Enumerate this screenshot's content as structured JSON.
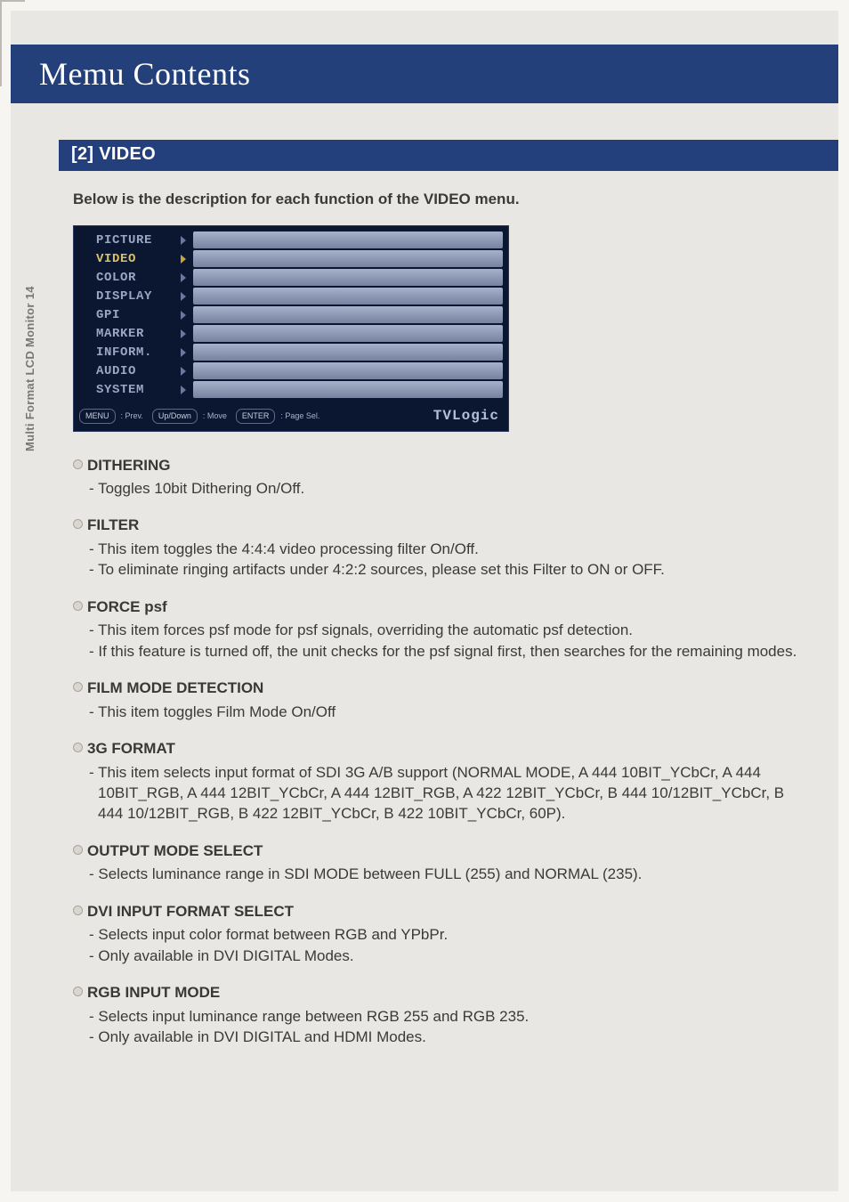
{
  "page": {
    "title": "Memu Contents",
    "section": "[2] VIDEO",
    "sidebar": "Multi Format LCD Monitor 14",
    "intro": "Below is the description for each function of the VIDEO menu."
  },
  "osd": {
    "menu": [
      "PICTURE",
      "VIDEO",
      "COLOR",
      "DISPLAY",
      "GPI",
      "MARKER",
      "INFORM.",
      "AUDIO",
      "SYSTEM"
    ],
    "selected_index": 1,
    "footer": {
      "prev_btn": "MENU",
      "prev_lbl": ": Prev.",
      "move_btn": "Up/Down",
      "move_lbl": ": Move",
      "page_btn": "ENTER",
      "page_lbl": ": Page Sel.",
      "logo": "TVLogic"
    }
  },
  "items": [
    {
      "heading": "DITHERING",
      "bullets": [
        " Toggles 10bit Dithering On/Off."
      ]
    },
    {
      "heading": "FILTER",
      "bullets": [
        "This item toggles the 4:4:4 video processing filter On/Off.",
        "To eliminate ringing artifacts under 4:2:2 sources, please set this Filter to ON or OFF."
      ]
    },
    {
      "heading": "FORCE psf",
      "bullets": [
        "This item forces psf mode for psf signals, overriding the automatic psf detection.",
        "If this feature is turned off, the unit checks for the psf signal first, then searches for the remaining modes."
      ]
    },
    {
      "heading": "FILM MODE DETECTION",
      "bullets": [
        "This item toggles Film Mode On/Off"
      ]
    },
    {
      "heading": " 3G FORMAT",
      "bullets": [
        "This item selects input format of SDI 3G A/B support (NORMAL MODE, A 444 10BIT_YCbCr, A 444 10BIT_RGB, A 444 12BIT_YCbCr, A 444 12BIT_RGB, A 422 12BIT_YCbCr, B 444 10/12BIT_YCbCr, B 444 10/12BIT_RGB, B 422 12BIT_YCbCr, B 422 10BIT_YCbCr, 60P)."
      ]
    },
    {
      "heading": "OUTPUT MODE SELECT",
      "bullets": [
        "Selects luminance range in SDI MODE between FULL (255) and NORMAL (235)."
      ]
    },
    {
      "heading": "DVI INPUT FORMAT SELECT",
      "bullets": [
        "Selects input color format between RGB and YPbPr.",
        "Only available in DVI DIGITAL Modes."
      ]
    },
    {
      "heading": "RGB INPUT MODE",
      "bullets": [
        "Selects input luminance range between RGB 255 and RGB 235.",
        "Only available in DVI DIGITAL and HDMI Modes."
      ]
    }
  ]
}
